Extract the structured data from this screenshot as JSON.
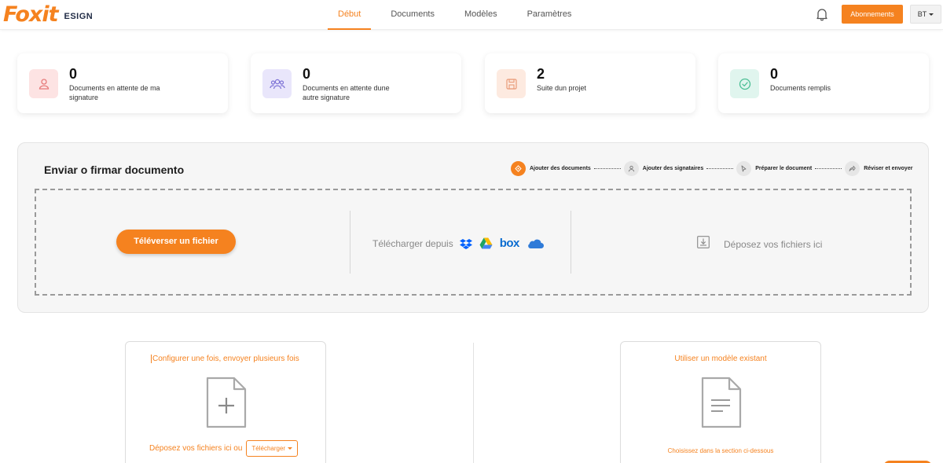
{
  "app": {
    "logo_brand": "Foxit",
    "logo_product": "ESIGN"
  },
  "nav": {
    "items": [
      {
        "label": "Début",
        "active": true
      },
      {
        "label": "Documents",
        "active": false
      },
      {
        "label": "Modèles",
        "active": false
      },
      {
        "label": "Paramètres",
        "active": false
      }
    ]
  },
  "header": {
    "notification_icon": "bell-icon",
    "subscriptions_label": "Abonnements",
    "user_label": "BT"
  },
  "stats": [
    {
      "value": "0",
      "label": "Documents en attente de ma signature",
      "icon": "user-icon",
      "color": "#fde3e3"
    },
    {
      "value": "0",
      "label": "Documents en attente dune autre signature",
      "icon": "users-icon",
      "color": "#e9e6fb"
    },
    {
      "value": "2",
      "label": "Suite dun projet",
      "icon": "save-icon",
      "color": "#fdeae0"
    },
    {
      "value": "0",
      "label": "Documents remplis",
      "icon": "check-circle-icon",
      "color": "#e0f5ee"
    }
  ],
  "send": {
    "title": "Enviar o firmar documento",
    "steps": [
      {
        "label": "Ajouter des documents",
        "active": true
      },
      {
        "label": "Ajouter des signataires",
        "active": false
      },
      {
        "label": "Préparer le document",
        "active": false
      },
      {
        "label": "Réviser et envoyer",
        "active": false
      }
    ],
    "upload_label": "Téléverser un fichier",
    "download_from_label": "Télécharger depuis",
    "cloud_services": [
      "dropbox-icon",
      "google-drive-icon",
      "box-icon",
      "onedrive-icon"
    ],
    "box_text": "box",
    "drop_files_label": "Déposez vos fichiers ici"
  },
  "templates": {
    "configure_title": "Configurer une fois, envoyer plusieurs fois",
    "configure_drop": "Déposez vos fichiers ici ou",
    "configure_button": "Télécharger",
    "existing_title": "Utiliser un modèle existant",
    "existing_hint": "Choisissez dans la section ci-dessous"
  },
  "colors": {
    "accent": "#f5821f"
  }
}
